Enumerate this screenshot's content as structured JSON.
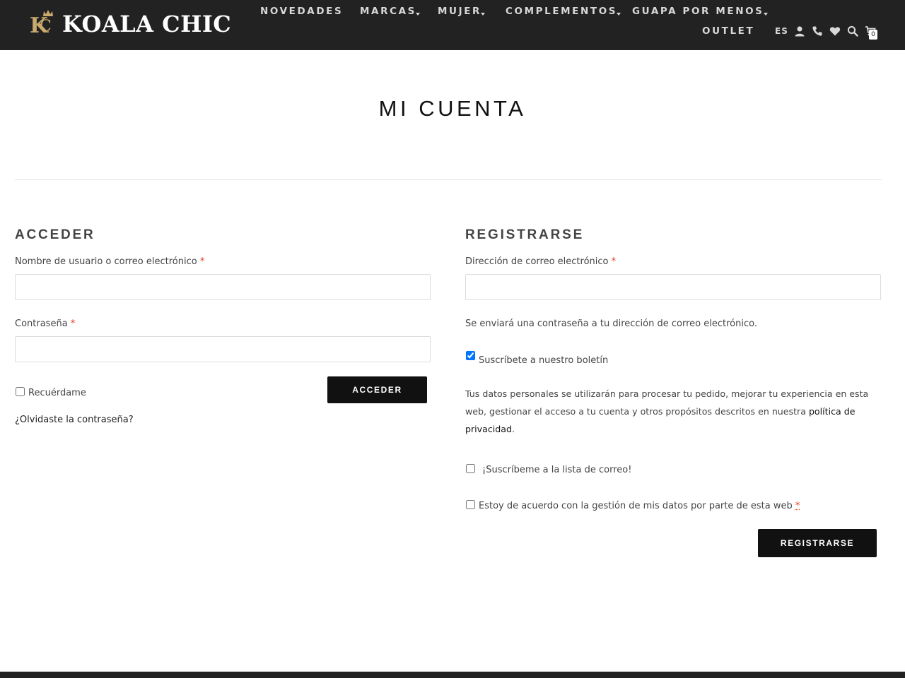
{
  "brand": {
    "name": "KOALA CHIC",
    "monogram": "KC",
    "accent": "#c9a96e"
  },
  "colors": {
    "header_bg": "#222222",
    "button_bg": "#111111",
    "required": "#e2401c"
  },
  "nav": {
    "novedades": "NOVEDADES",
    "marcas": "MARCAS",
    "mujer": "MUJER",
    "complementos": "COMPLEMENTOS",
    "guapa": "GUAPA POR MENOS",
    "outlet": "OUTLET"
  },
  "tools": {
    "lang": "ES",
    "cart_count": "0",
    "icons": [
      "user-icon",
      "phone-icon",
      "heart-icon",
      "search-icon",
      "cart-icon"
    ]
  },
  "page": {
    "title": "MI CUENTA"
  },
  "login": {
    "title": "ACCEDER",
    "username_label": "Nombre de usuario o correo electrónico",
    "password_label": "Contraseña",
    "required_mark": "*",
    "remember_label": "Recuérdame",
    "remember_checked": false,
    "submit_label": "ACCEDER",
    "lost_password": "¿Olvidaste la contraseña?"
  },
  "register": {
    "title": "REGISTRARSE",
    "email_label": "Dirección de correo electrónico",
    "required_mark": "*",
    "password_note": "Se enviará una contraseña a tu dirección de correo electrónico.",
    "newsletter_label": "Suscríbete a nuestro boletín",
    "newsletter_checked": true,
    "privacy_text": "Tus datos personales se utilizarán para procesar tu pedido, mejorar tu experiencia en esta web, gestionar el acceso a tu cuenta y otros propósitos descritos en nuestra ",
    "privacy_link": "política de privacidad",
    "privacy_end": ".",
    "mailing_label": "¡Suscríbeme a la lista de correo!",
    "mailing_checked": false,
    "consent_label": "Estoy de acuerdo con la gestión de mis datos por parte de esta web",
    "consent_checked": false,
    "submit_label": "REGISTRARSE"
  }
}
